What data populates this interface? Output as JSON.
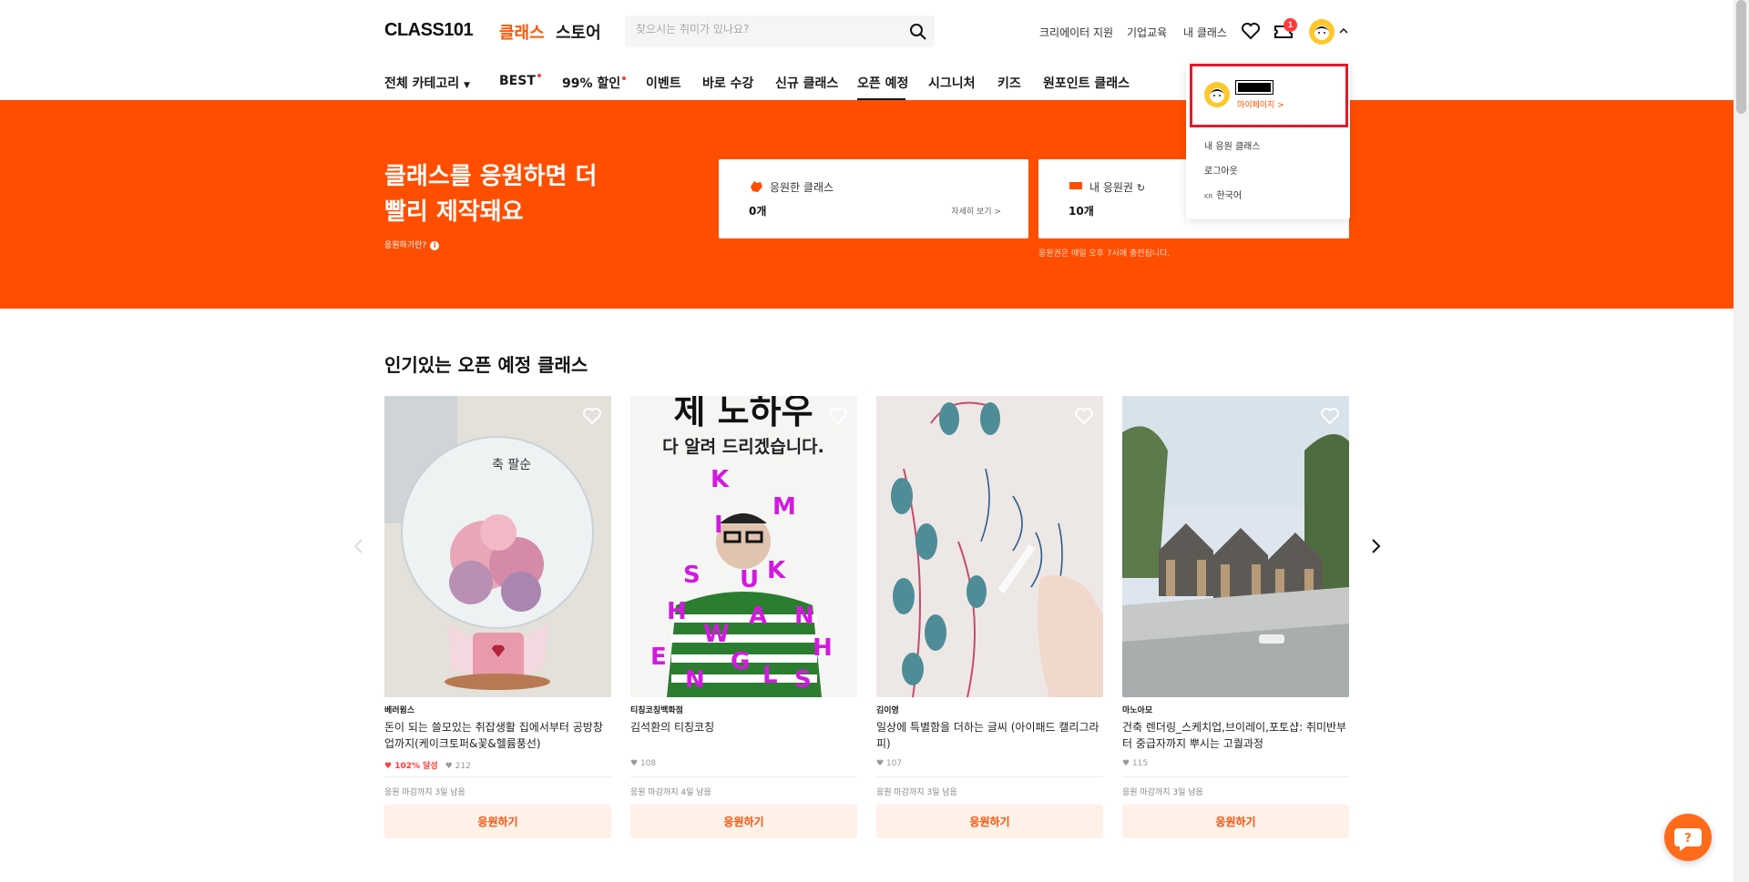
{
  "header": {
    "logo": "CLASS101",
    "tabs": [
      "클래스",
      "스토어"
    ],
    "search_placeholder": "찾으시는 취미가 있나요?",
    "links": [
      "크리에이터 지원",
      "기업교육",
      "내 클래스"
    ],
    "notification_count": "1"
  },
  "nav": {
    "categories": [
      "전체 카테고리",
      "BEST",
      "99% 할인",
      "이벤트",
      "바로 수강",
      "신규 클래스",
      "오픈 예정",
      "시그니처",
      "키즈",
      "원포인트 클래스"
    ],
    "active": "오픈 예정"
  },
  "hero": {
    "title": "클래스를 응원하면 더 빨리 제작돼요",
    "help_label": "응원하기란?",
    "cards": [
      {
        "label": "응원한 클래스",
        "value": "0개",
        "link": "자세히 보기 >"
      },
      {
        "label": "내 응원권",
        "value": "10개"
      }
    ],
    "note": "응원권은 매일 오후 7시에 충전됩니다."
  },
  "section": {
    "title": "인기있는 오픈 예정 클래스"
  },
  "classes": [
    {
      "creator": "베러윔스",
      "title": "돈이 되는 쓸모있는 취잡생활 집에서부터 공방창업까지(케이크토퍼&꽃&헬륨풍선)",
      "funding": "102% 달성",
      "likes": "212",
      "deadline": "응원 마감까지 3일 남음",
      "button": "응원하기"
    },
    {
      "creator": "티칭코칭백화점",
      "title": "김석환의 티칭코칭",
      "likes": "108",
      "deadline": "응원 마감까지 4일 남음",
      "button": "응원하기"
    },
    {
      "creator": "김이영",
      "title": "일상에 특별함을 더하는 글씨 (아이패드 캘리그라피)",
      "likes": "107",
      "deadline": "응원 마감까지 3일 남음",
      "button": "응원하기"
    },
    {
      "creator": "마노아모",
      "title": "건축 렌더링_스케치업,브이레이,포토샵: 취미반부터 중급자까지 뿌시는 고퀄과정",
      "likes": "115",
      "deadline": "응원 마감까지 3일 남음",
      "button": "응원하기"
    }
  ],
  "thumb_text": {
    "card2_top": "제 노하우",
    "card2_sub": "다 알려 드리겠습니다.",
    "card1_note": "축 팔순"
  },
  "dropdown": {
    "mypage": "마이페이지 >",
    "items": [
      "내 응원 클래스",
      "로그아웃",
      "한국어"
    ],
    "lang_code": "KR"
  },
  "colors": {
    "brand": "#ff4e00",
    "highlight": "#e31a2b"
  }
}
